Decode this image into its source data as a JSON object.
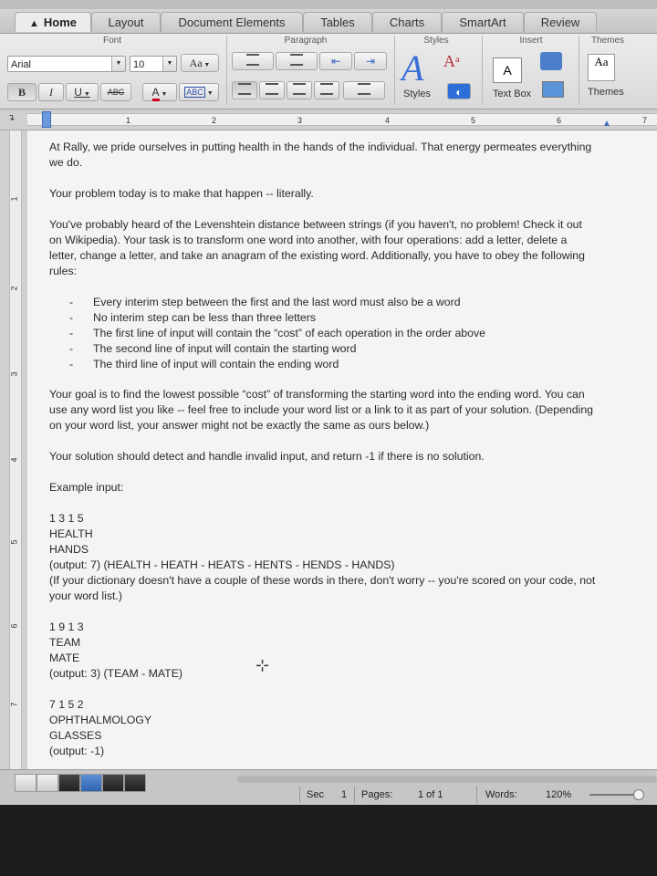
{
  "tabs": {
    "home": "Home",
    "layout": "Layout",
    "document_elements": "Document Elements",
    "tables": "Tables",
    "charts": "Charts",
    "smartart": "SmartArt",
    "review": "Review"
  },
  "ribbon": {
    "groups": {
      "font": "Font",
      "paragraph": "Paragraph",
      "styles": "Styles",
      "insert": "Insert",
      "themes": "Themes"
    },
    "font_name": "Arial",
    "font_size": "10",
    "grow_font": "Aa",
    "bold": "B",
    "italic": "I",
    "underline": "U",
    "strikethrough": "ABC",
    "font_color": "A",
    "highlight": "ABC",
    "styles_label": "Styles",
    "textbox_label": "Text Box",
    "themes_label": "Themes",
    "themes_preview": "Aa"
  },
  "ruler": {
    "marks": [
      "1",
      "2",
      "3",
      "4",
      "5",
      "6",
      "7"
    ]
  },
  "vruler": {
    "marks": [
      "1",
      "2",
      "3",
      "4",
      "5",
      "6",
      "7"
    ]
  },
  "document": {
    "intro": "At Rally, we pride ourselves in putting health in the hands of the individual. That energy permeates everything we do.",
    "problem": "Your problem today is to make that happen -- literally.",
    "task": "You've probably heard of the Levenshtein distance between strings (if you haven't, no problem! Check it out on Wikipedia).  Your task is to transform one word into another, with four operations: add a letter, delete a letter, change a letter, and take an anagram of the existing word.  Additionally, you have to obey the following rules:",
    "rules": [
      "Every interim step between the first and the last word must also be a word",
      "No interim step can be less than three letters",
      "The first line of input will contain the “cost” of each operation in the order above",
      "The second line of input will contain the starting word",
      "The third line of input will contain the ending word"
    ],
    "goal": "Your goal is to find the lowest possible “cost” of transforming the starting word into the ending word.  You can use any word list you like -- feel free to include your word list or a link to it as part of your solution. (Depending on your word list, your answer might not be exactly the same as ours below.)",
    "invalid": "Your solution should detect and handle invalid input, and return -1 if there is no solution.",
    "example_heading": "Example input:",
    "ex1": {
      "costs": "1 3 1 5",
      "start": "HEALTH",
      "end": "HANDS",
      "output": "(output: 7) (HEALTH - HEATH - HEATS - HENTS - HENDS - HANDS)",
      "note": "(If your dictionary doesn't have a couple of these words in there, don't worry -- you're scored on your code, not your word list.)"
    },
    "ex2": {
      "costs": "1 9 1 3",
      "start": "TEAM",
      "end": "MATE",
      "output": "(output: 3) (TEAM - MATE)"
    },
    "ex3": {
      "costs": "7 1 5 2",
      "start": "OPHTHALMOLOGY",
      "end": "GLASSES",
      "output": "(output: -1)"
    }
  },
  "status": {
    "sec_label": "Sec",
    "sec_value": "1",
    "pages_label": "Pages:",
    "pages_value": "1 of 1",
    "words_label": "Words:",
    "zoom": "120%"
  }
}
